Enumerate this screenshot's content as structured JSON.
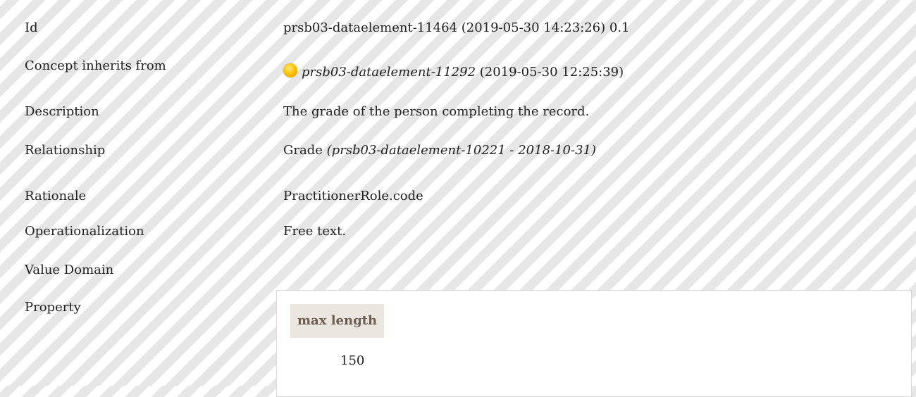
{
  "rows": [
    {
      "label": "Id",
      "value": "prsb03-dataelement-11464 (2019-05-30 14:23:26) 0.1"
    },
    {
      "label": "Concept inherits from",
      "value_italic": "prsb03-dataelement-11292",
      "value_suffix": " (2019-05-30 12:25:39)"
    },
    {
      "label": "Description",
      "value": "The grade of the person completing the record."
    },
    {
      "label": "Relationship",
      "value_prefix": "Grade ",
      "value_italic": "(prsb03-dataelement-10221 - 2018-10-31)"
    },
    {
      "label": "Rationale",
      "value": "PractitionerRole.code"
    },
    {
      "label": "Operationalization",
      "value": "Free text."
    },
    {
      "label": "Value Domain",
      "value": ""
    },
    {
      "label": "Property"
    }
  ],
  "property": {
    "header": "max length",
    "value": "150"
  },
  "status_icon": {
    "name": "status-circle-icon",
    "color": "#ffc400"
  }
}
